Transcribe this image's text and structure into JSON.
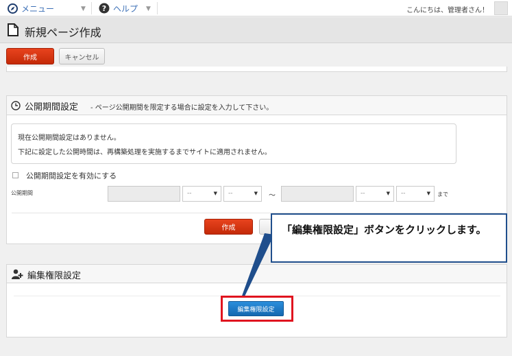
{
  "topbar": {
    "menu_label": "メニュー",
    "help_label": "ヘルプ",
    "greeting": "こんにちは、管理者さん！"
  },
  "page": {
    "title": "新規ページ作成"
  },
  "toolbar": {
    "create_label": "作成",
    "cancel_label": "キャンセル"
  },
  "publish_section": {
    "title": "公開期間設定",
    "subtitle": "- ページ公開期間を限定する場合に設定を入力して下さい。",
    "info_line1": "現在公開期間設定はありません。",
    "info_line2": "下記に設定した公開時間は、再構築処理を実施するまでサイトに適用されません。",
    "enable_checkbox_label": "公開期間設定を有効にする",
    "period_label": "公開期間",
    "select_placeholder": "--",
    "tilde": "～",
    "until_label": "まで",
    "create_label": "作成"
  },
  "permission_section": {
    "title": "編集権限設定",
    "button_label": "編集権限設定"
  },
  "callout": {
    "text": "「編集権限設定」ボタンをクリックします。"
  },
  "colors": {
    "primary_red": "#d5360f",
    "accent_blue": "#1a7ac7",
    "callout_border": "#1f4e8c",
    "highlight_red": "#e0141f"
  }
}
